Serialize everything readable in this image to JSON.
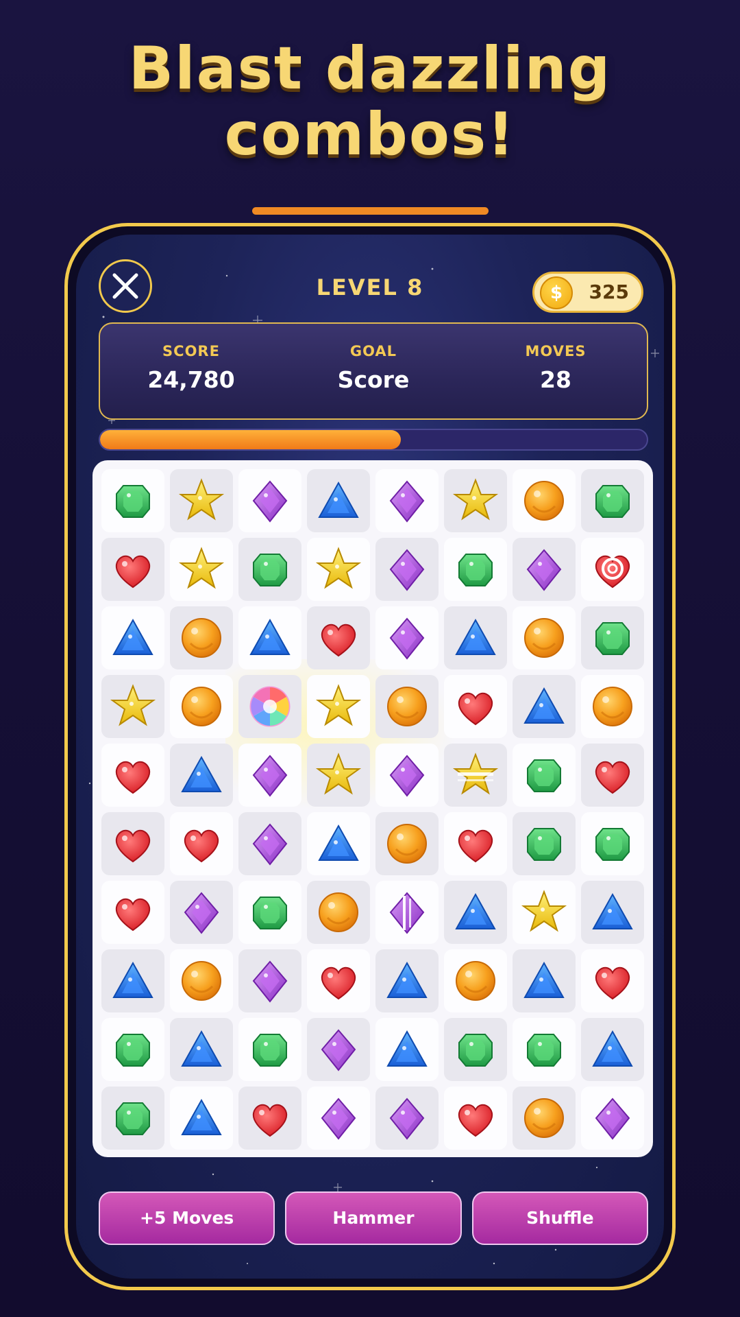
{
  "headline": {
    "line1": "Blast dazzling",
    "line2": "combos!"
  },
  "header": {
    "level_title": "LEVEL 8",
    "coin_symbol": "$",
    "coins": "325"
  },
  "stats": [
    {
      "label": "SCORE",
      "value": "24,780"
    },
    {
      "label": "GOAL",
      "value": "Score"
    },
    {
      "label": "MOVES",
      "value": "28"
    }
  ],
  "progress": {
    "fraction": 0.55
  },
  "board": {
    "rows": 10,
    "cols": 8,
    "grid": [
      [
        "green",
        "star",
        "purple",
        "blue",
        "purple",
        "star",
        "orange",
        "green"
      ],
      [
        "heart",
        "star",
        "green",
        "star",
        "purple",
        "green",
        "purple",
        "heart-target"
      ],
      [
        "blue",
        "orange",
        "blue",
        "heart",
        "purple",
        "blue",
        "orange",
        "green"
      ],
      [
        "star",
        "orange",
        "rainbow",
        "star",
        "orange",
        "heart",
        "blue",
        "orange"
      ],
      [
        "heart",
        "blue",
        "purple",
        "star",
        "purple",
        "star-striped",
        "green",
        "heart"
      ],
      [
        "heart",
        "heart",
        "purple",
        "blue",
        "orange",
        "heart",
        "green",
        "green"
      ],
      [
        "heart",
        "purple",
        "green",
        "orange",
        "purple-striped",
        "blue",
        "star",
        "blue"
      ],
      [
        "blue",
        "orange",
        "purple",
        "heart",
        "blue",
        "orange",
        "blue",
        "heart"
      ],
      [
        "green",
        "blue",
        "green",
        "purple",
        "blue",
        "green",
        "green",
        "blue"
      ],
      [
        "green",
        "blue",
        "heart",
        "purple",
        "purple",
        "heart",
        "orange",
        "purple"
      ]
    ],
    "shading": [
      [
        "light",
        "dark",
        "light",
        "dark",
        "light",
        "dark",
        "light",
        "dark"
      ],
      [
        "dark",
        "light",
        "dark",
        "light",
        "dark",
        "light",
        "dark",
        "light"
      ],
      [
        "light",
        "dark",
        "light",
        "dark",
        "light",
        "dark",
        "light",
        "dark"
      ],
      [
        "dark",
        "light",
        "dark",
        "light",
        "dark",
        "light",
        "dark",
        "light"
      ],
      [
        "light",
        "dark",
        "light",
        "dark",
        "light",
        "dark",
        "light",
        "dark"
      ],
      [
        "dark",
        "light",
        "dark",
        "light",
        "dark",
        "light",
        "dark",
        "light"
      ],
      [
        "light",
        "dark",
        "light",
        "dark",
        "light",
        "dark",
        "light",
        "dark"
      ],
      [
        "dark",
        "light",
        "dark",
        "light",
        "dark",
        "light",
        "dark",
        "light"
      ],
      [
        "light",
        "dark",
        "light",
        "dark",
        "light",
        "dark",
        "light",
        "dark"
      ],
      [
        "dark",
        "light",
        "dark",
        "light",
        "dark",
        "light",
        "dark",
        "light"
      ]
    ]
  },
  "boosters": [
    {
      "label": "+5 Moves"
    },
    {
      "label": "Hammer"
    },
    {
      "label": "Shuffle"
    }
  ],
  "colors": {
    "accent_gold": "#f7d774",
    "accent_orange": "#f08a24",
    "booster_purple": "#b93aa8"
  }
}
